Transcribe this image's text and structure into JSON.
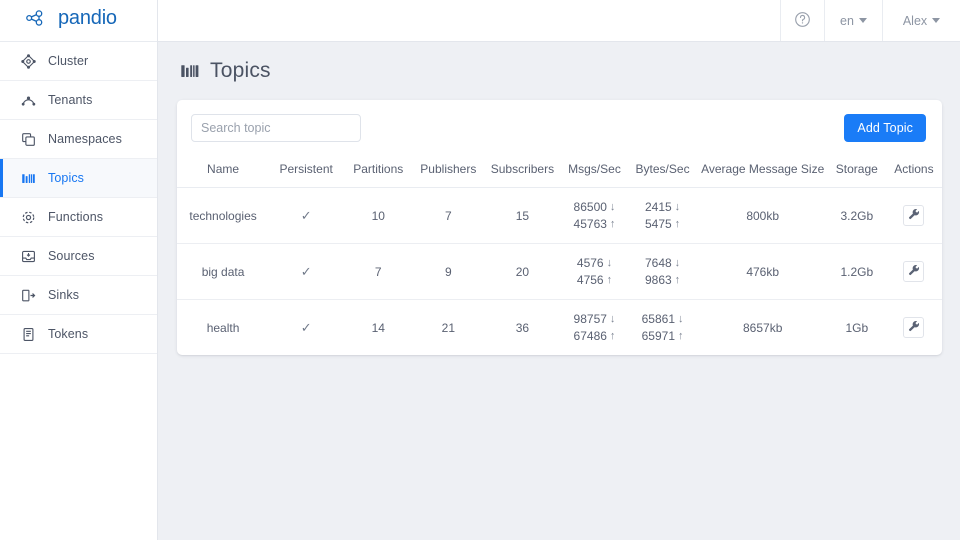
{
  "brand": {
    "name": "pandio",
    "logo_icon": "pandio-node-graph-logo",
    "color": "#1667b8"
  },
  "sidebar": {
    "items": [
      {
        "label": "Cluster",
        "icon": "cluster-icon",
        "active": false
      },
      {
        "label": "Tenants",
        "icon": "tenants-icon",
        "active": false
      },
      {
        "label": "Namespaces",
        "icon": "namespaces-icon",
        "active": false
      },
      {
        "label": "Topics",
        "icon": "topics-icon",
        "active": true
      },
      {
        "label": "Functions",
        "icon": "functions-icon",
        "active": false
      },
      {
        "label": "Sources",
        "icon": "sources-icon",
        "active": false
      },
      {
        "label": "Sinks",
        "icon": "sinks-icon",
        "active": false
      },
      {
        "label": "Tokens",
        "icon": "tokens-icon",
        "active": false
      }
    ],
    "active_color": "#1877f2"
  },
  "topbar": {
    "help_icon": "help-circle-icon",
    "language": "en",
    "user": "Alex"
  },
  "page": {
    "title": "Topics",
    "icon": "topics-bar-icon"
  },
  "toolbar": {
    "search_placeholder": "Search topic",
    "search_value": "",
    "add_topic_label": "Add Topic",
    "primary_color": "#1a7cf7"
  },
  "table": {
    "columns": [
      "Name",
      "Persistent",
      "Partitions",
      "Publishers",
      "Subscribers",
      "Msgs/Sec",
      "Bytes/Sec",
      "Average Message Size",
      "Storage",
      "Actions"
    ],
    "rows": [
      {
        "name": "technologies",
        "persistent": "✓",
        "partitions": "10",
        "publishers": "7",
        "subscribers": "15",
        "msgs_in": "86500",
        "msgs_out": "45763",
        "bytes_in": "2415",
        "bytes_out": "5475",
        "average_message_size": "800kb",
        "storage": "3.2Gb",
        "action_icon": "wrench-icon"
      },
      {
        "name": "big data",
        "persistent": "✓",
        "partitions": "7",
        "publishers": "9",
        "subscribers": "20",
        "msgs_in": "4576",
        "msgs_out": "4756",
        "bytes_in": "7648",
        "bytes_out": "9863",
        "average_message_size": "476kb",
        "storage": "1.2Gb",
        "action_icon": "wrench-icon"
      },
      {
        "name": "health",
        "persistent": "✓",
        "partitions": "14",
        "publishers": "21",
        "subscribers": "36",
        "msgs_in": "98757",
        "msgs_out": "67486",
        "bytes_in": "65861",
        "bytes_out": "65971",
        "average_message_size": "8657kb",
        "storage": "1Gb",
        "action_icon": "wrench-icon"
      }
    ],
    "down_arrow": "↓",
    "up_arrow": "↑"
  }
}
